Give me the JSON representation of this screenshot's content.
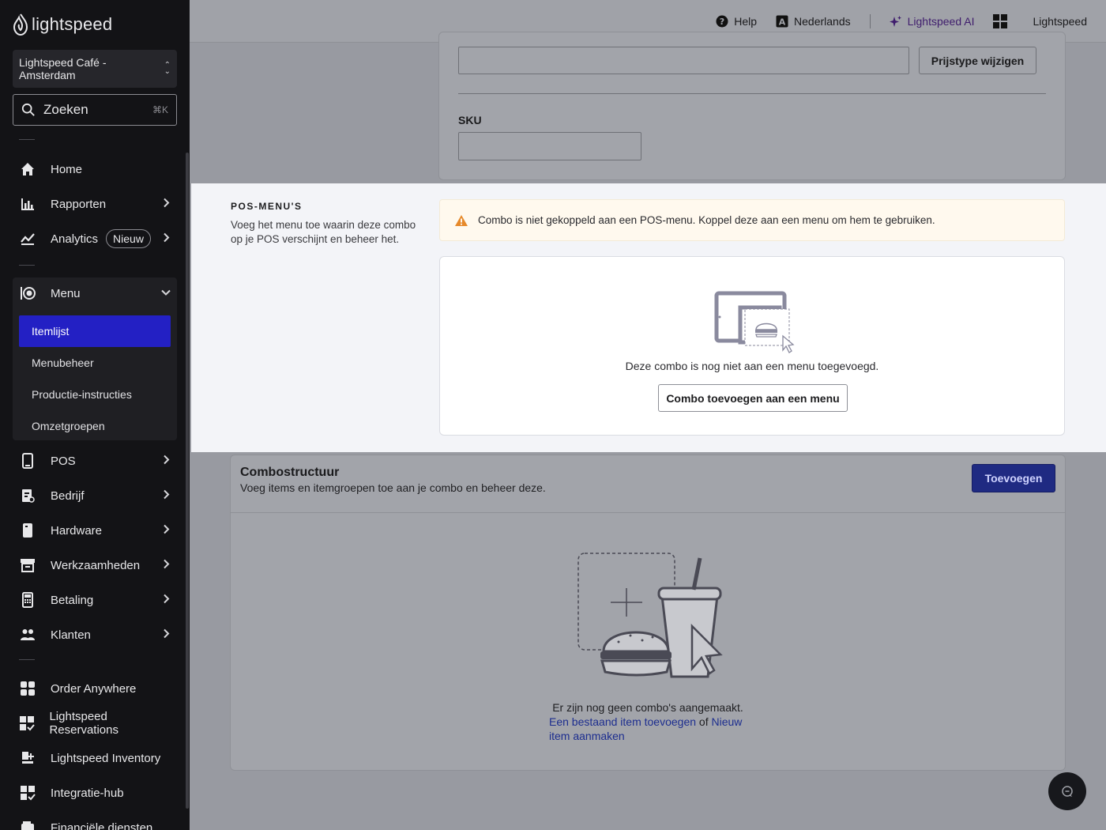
{
  "sidebar": {
    "brand": "lightspeed",
    "store": "Lightspeed Café - Amsterdam",
    "search_placeholder": "Zoeken",
    "search_shortcut": "⌘K",
    "nav_top": [
      {
        "label": "Home",
        "icon": "home-icon"
      },
      {
        "label": "Rapporten",
        "icon": "bar-chart-icon"
      },
      {
        "label": "Analytics",
        "icon": "trend-icon",
        "badge": "Nieuw"
      }
    ],
    "menu": {
      "label": "Menu",
      "items": [
        "Itemlijst",
        "Menubeheer",
        "Productie-instructies",
        "Omzetgroepen"
      ]
    },
    "nav_mid": [
      "POS",
      "Bedrijf",
      "Hardware",
      "Werkzaamheden",
      "Betaling",
      "Klanten"
    ],
    "nav_apps": [
      "Order Anywhere",
      "Lightspeed Reservations",
      "Lightspeed Inventory",
      "Integratie-hub",
      "Financiële diensten"
    ]
  },
  "topbar": {
    "help": "Help",
    "language": "Nederlands",
    "ai": "Lightspeed AI",
    "account": "Lightspeed"
  },
  "details": {
    "change_price_type": "Prijstype wijzigen",
    "sku_label": "SKU"
  },
  "pos_menus": {
    "title": "POS-MENU'S",
    "description": "Voeg het menu toe waarin deze combo op je POS verschijnt en beheer het.",
    "warning": "Combo is niet gekoppeld aan een POS-menu. Koppel deze aan een menu om hem te gebruiken.",
    "empty_text": "Deze combo is nog niet aan een menu toegevoegd.",
    "add_button": "Combo toevoegen aan een menu"
  },
  "combo_structure": {
    "title": "Combostructuur",
    "subtitle": "Voeg items en itemgroepen toe aan je combo en beheer deze.",
    "add_button": "Toevoegen",
    "empty_line": "Er zijn nog geen combo's aangemaakt.",
    "link_existing": "Een bestaand item toevoegen",
    "or_word": "of",
    "link_new": "Nieuw item aanmaken"
  },
  "colors": {
    "sidebar_bg": "#131316",
    "active_item": "#2320c4",
    "primary_button": "#1f2a82",
    "warning_icon": "#e6892a",
    "ai_accent": "#3f1d6d"
  }
}
